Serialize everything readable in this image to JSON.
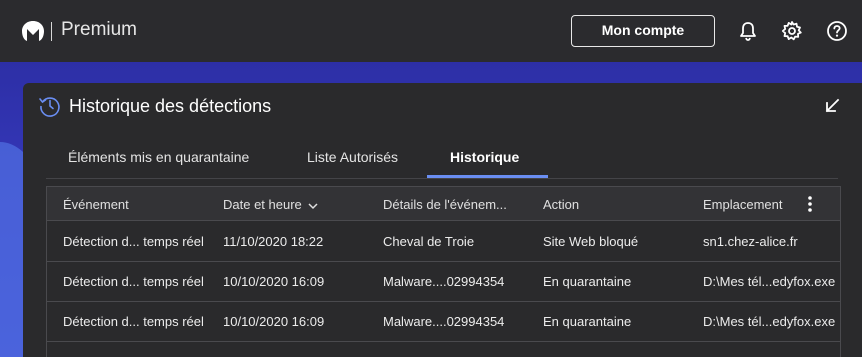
{
  "header": {
    "brand": "Premium",
    "account_button": "Mon compte",
    "icons": [
      "malwarebytes-logo-icon",
      "bell-icon",
      "gear-icon",
      "help-icon"
    ]
  },
  "panel": {
    "title": "Historique des détections",
    "title_icon": "clock-history-icon",
    "collapse_icon": "collapse-arrow-icon",
    "tabs": [
      {
        "label": "Éléments mis en quarantaine",
        "active": false
      },
      {
        "label": "Liste Autorisés",
        "active": false
      },
      {
        "label": "Historique",
        "active": true
      }
    ],
    "accent_color": "#6a8ef2"
  },
  "table": {
    "columns": [
      "Événement",
      "Date et heure",
      "Détails de l'événem...",
      "Action",
      "Emplacement"
    ],
    "sort_column": "Date et heure",
    "rows": [
      {
        "event": "Détection d... temps réel",
        "datetime": "11/10/2020 18:22",
        "details": "Cheval de Troie",
        "action": "Site Web bloqué",
        "location": "sn1.chez-alice.fr"
      },
      {
        "event": "Détection d... temps réel",
        "datetime": "10/10/2020 16:09",
        "details": "Malware....02994354",
        "action": "En quarantaine",
        "location": "D:\\Mes tél...edyfox.exe"
      },
      {
        "event": "Détection d... temps réel",
        "datetime": "10/10/2020 16:09",
        "details": "Malware....02994354",
        "action": "En quarantaine",
        "location": "D:\\Mes tél...edyfox.exe"
      }
    ]
  }
}
